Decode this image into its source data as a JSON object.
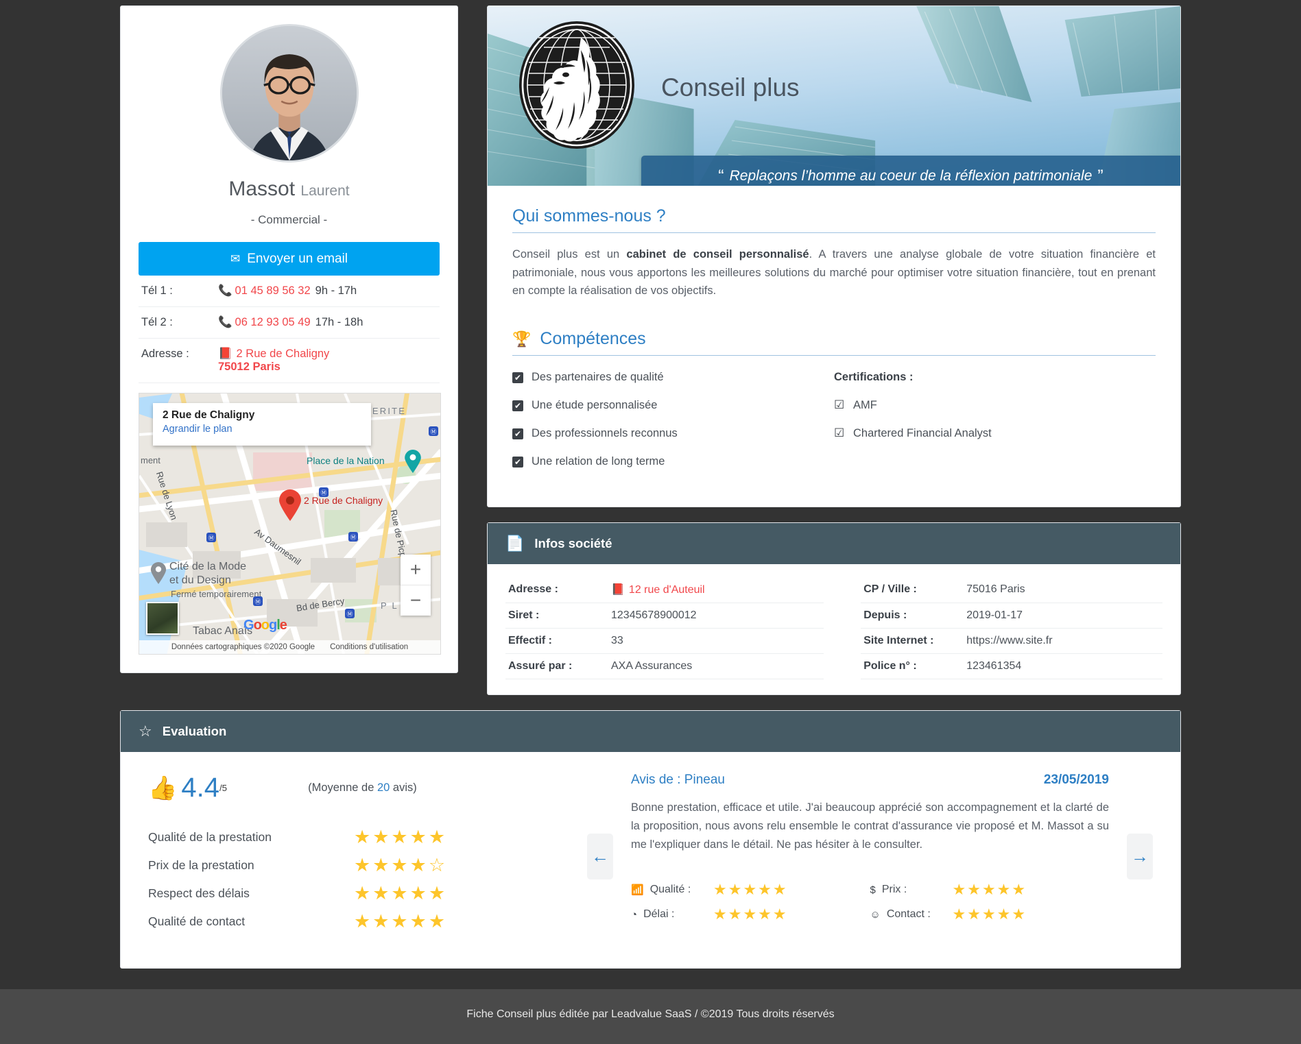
{
  "profile": {
    "last_name": "Massot",
    "first_name": "Laurent",
    "role": "- Commercial -",
    "email_button": "Envoyer un email",
    "rows": [
      {
        "label": "Tél 1 :",
        "value": "01 45 89 56 32",
        "hours": "9h - 17h"
      },
      {
        "label": "Tél 2 :",
        "value": "06 12 93 05 49",
        "hours": "17h - 18h"
      }
    ],
    "address": {
      "label": "Adresse :",
      "street": "2 Rue de Chaligny",
      "city": "75012 Paris"
    }
  },
  "map": {
    "infobox_title": "2 Rue de Chaligny",
    "infobox_link": "Agrandir le plan",
    "pin_label": "2 Rue de Chaligny",
    "labels": [
      "GUERITE",
      "Place de la Nation",
      "Rue de Lyon",
      "Rue de Picpus",
      "Av Daumesnil",
      "Cité de la Mode",
      "et du Design",
      "Fermé temporairement",
      "Bd de Bercy",
      "Tabac Anaïs",
      "ment",
      "P L      S"
    ],
    "zoom_in": "+",
    "zoom_out": "−",
    "attribution": "Données cartographiques ©2020 Google",
    "terms": "Conditions d'utilisation",
    "brand": "Google"
  },
  "company": {
    "name": "Conseil plus",
    "quote": "Replaçons l’homme au coeur de la réflexion patrimoniale",
    "quote_open": "“",
    "quote_close": "”"
  },
  "about": {
    "title": "Qui sommes-nous ?",
    "text_1": "Conseil plus est un ",
    "text_bold": "cabinet de conseil personnalisé",
    "text_2": ". A travers une analyse globale de votre situation financière et patrimoniale, nous vous apportons les meilleures solutions du marché pour optimiser votre situation financière, tout en prenant en compte la réalisation de vos objectifs."
  },
  "skills": {
    "title": "Compétences",
    "icon": "trophy-icon",
    "items": [
      "Des partenaires de qualité",
      "Une étude personnalisée",
      "Des professionnels reconnus",
      "Une relation de long terme"
    ],
    "certifications_title": "Certifications :",
    "certifications": [
      "AMF",
      "Chartered Financial Analyst"
    ]
  },
  "infos": {
    "title": "Infos société",
    "icon": "document-icon",
    "rows": [
      {
        "k1": "Adresse :",
        "v1": "12 rue d'Auteuil",
        "v1_red": true,
        "k2": "CP / Ville :",
        "v2": "75016 Paris"
      },
      {
        "k1": "Siret :",
        "v1": "12345678900012",
        "v1_red": false,
        "k2": "Depuis :",
        "v2": "2019-01-17"
      },
      {
        "k1": "Effectif :",
        "v1": "33",
        "v1_red": false,
        "k2": "Site Internet :",
        "v2": "https://www.site.fr"
      },
      {
        "k1": "Assuré par :",
        "v1": "AXA Assurances",
        "v1_red": false,
        "k2": "Police n° :",
        "v2": "123461354"
      }
    ]
  },
  "evaluation": {
    "title": "Evaluation",
    "icon": "star-outline-icon",
    "score": "4.4",
    "score_suffix": "/5",
    "average_prefix": "(Moyenne de ",
    "average_count": "20",
    "average_suffix": " avis)",
    "criteria": [
      {
        "label": "Qualité de la prestation",
        "filled": 5
      },
      {
        "label": "Prix de la prestation",
        "filled": 4
      },
      {
        "label": "Respect des délais",
        "filled": 5
      },
      {
        "label": "Qualité de contact",
        "filled": 5
      }
    ],
    "prev_arrow": "←",
    "next_arrow": "→",
    "review": {
      "author": "Avis de : Pineau",
      "date": "23/05/2019",
      "text": "Bonne prestation, efficace et utile. J'ai beaucoup apprécié son accompagnement et la clarté de la proposition, nous avons relu ensemble le contrat d'assurance vie proposé et M. Massot a su me l'expliquer dans le détail. Ne pas hésiter à le consulter.",
      "ratings": [
        {
          "icon": "signal-bars-icon",
          "glyph": "▁▃▅",
          "label": "Qualité :",
          "filled": 5
        },
        {
          "icon": "clock-icon",
          "glyph": "◔",
          "label": "Délai :",
          "filled": 5
        },
        {
          "icon": "dollar-icon",
          "glyph": "$",
          "label": "Prix :",
          "filled": 5
        },
        {
          "icon": "smiley-icon",
          "glyph": "☺",
          "label": "Contact :",
          "filled": 5
        }
      ]
    }
  },
  "footer": {
    "text": "Fiche Conseil plus éditée par Leadvalue SaaS / ©2019 Tous droits réservés"
  },
  "colors": {
    "accent_blue": "#2e7fc4",
    "button_blue": "#00a3f0",
    "red": "#f1474b",
    "panel_dark": "#455a64",
    "star_yellow": "#fdc52b"
  }
}
